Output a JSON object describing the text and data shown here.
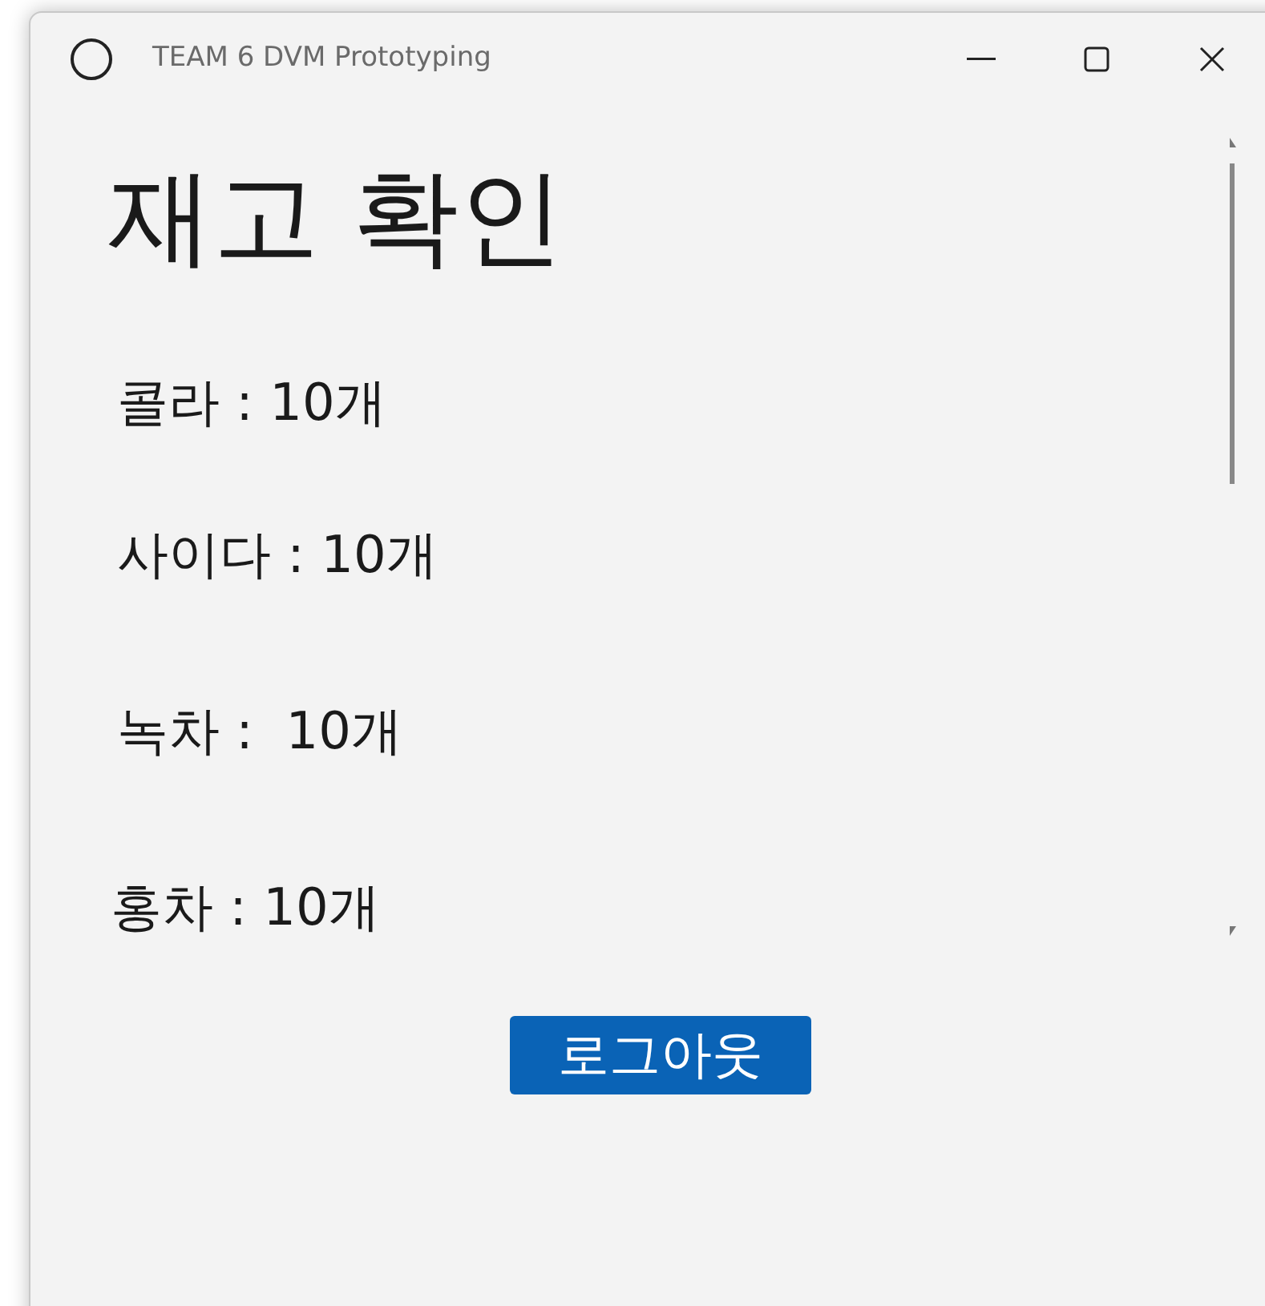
{
  "window": {
    "title": "TEAM 6 DVM Prototyping"
  },
  "heading": "재고 확인",
  "stock_items": [
    {
      "label": "콜라 : 10개"
    },
    {
      "label": "사이다 : 10개"
    },
    {
      "label": "녹차 :  10개"
    },
    {
      "label": "홍차 : 10개"
    }
  ],
  "logout_button": "로그아웃"
}
